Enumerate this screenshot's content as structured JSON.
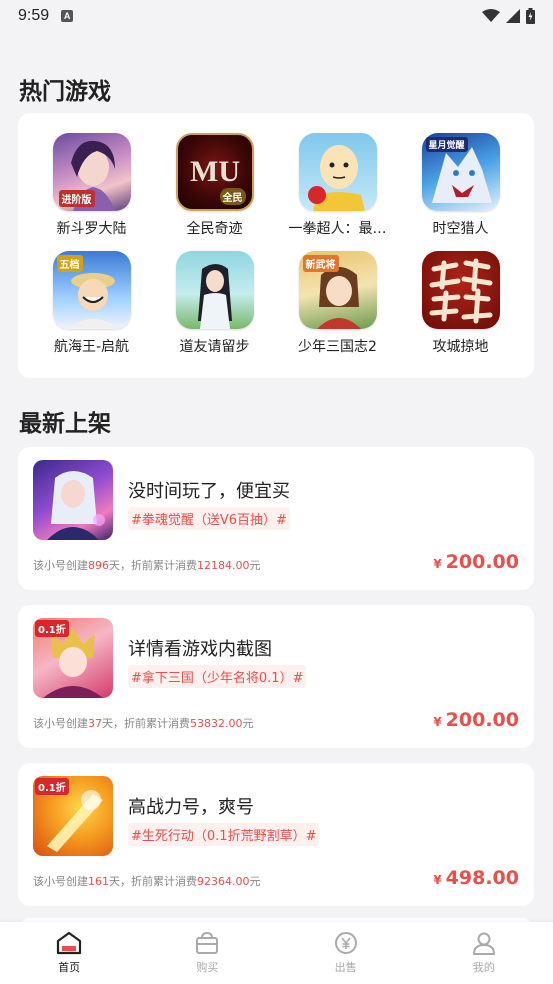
{
  "status_bar": {
    "time": "9:59",
    "notification_letter": "A"
  },
  "hot_games": {
    "title": "热门游戏",
    "items": [
      {
        "name": "新斗罗大陆",
        "badge": "进阶版"
      },
      {
        "name": "全民奇迹",
        "badge": "全民"
      },
      {
        "name": "一拳超人：最…",
        "badge": ""
      },
      {
        "name": "时空猎人",
        "badge": "星月觉醒"
      },
      {
        "name": "航海王-启航",
        "badge": "五档"
      },
      {
        "name": "道友请留步",
        "badge": ""
      },
      {
        "name": "少年三国志2",
        "badge": "新武将"
      },
      {
        "name": "攻城掠地",
        "badge": ""
      }
    ]
  },
  "new_listings": {
    "title": "最新上架",
    "items": [
      {
        "title": "没时间玩了，便宜买",
        "tag": "#拳魂觉醒（送V6百抽）#",
        "meta_prefix": "该小号创建",
        "days": "896",
        "meta_mid": "天，折前累计消费",
        "spent": "12184.00",
        "meta_suffix": "元",
        "currency": "¥",
        "price": "200.00",
        "thumb_badge": ""
      },
      {
        "title": "详情看游戏内截图",
        "tag": "#拿下三国（少年名将0.1）#",
        "meta_prefix": "该小号创建",
        "days": "37",
        "meta_mid": "天，折前累计消费",
        "spent": "53832.00",
        "meta_suffix": "元",
        "currency": "¥",
        "price": "200.00",
        "thumb_badge": "0.1折"
      },
      {
        "title": "高战力号，爽号",
        "tag": "#生死行动（0.1折荒野割草）#",
        "meta_prefix": "该小号创建",
        "days": "161",
        "meta_mid": "天，折前累计消费",
        "spent": "92364.00",
        "meta_suffix": "元",
        "currency": "¥",
        "price": "498.00",
        "thumb_badge": "0.1折"
      }
    ]
  },
  "tabbar": {
    "items": [
      {
        "label": "首页",
        "icon": "home-icon",
        "active": true
      },
      {
        "label": "购买",
        "icon": "shopping-basket-icon",
        "active": false
      },
      {
        "label": "出售",
        "icon": "yen-coin-icon",
        "active": false
      },
      {
        "label": "我的",
        "icon": "person-icon",
        "active": false
      }
    ]
  },
  "colors": {
    "accent": "#e8504b",
    "background": "#f3f3f5",
    "card": "#ffffff"
  }
}
